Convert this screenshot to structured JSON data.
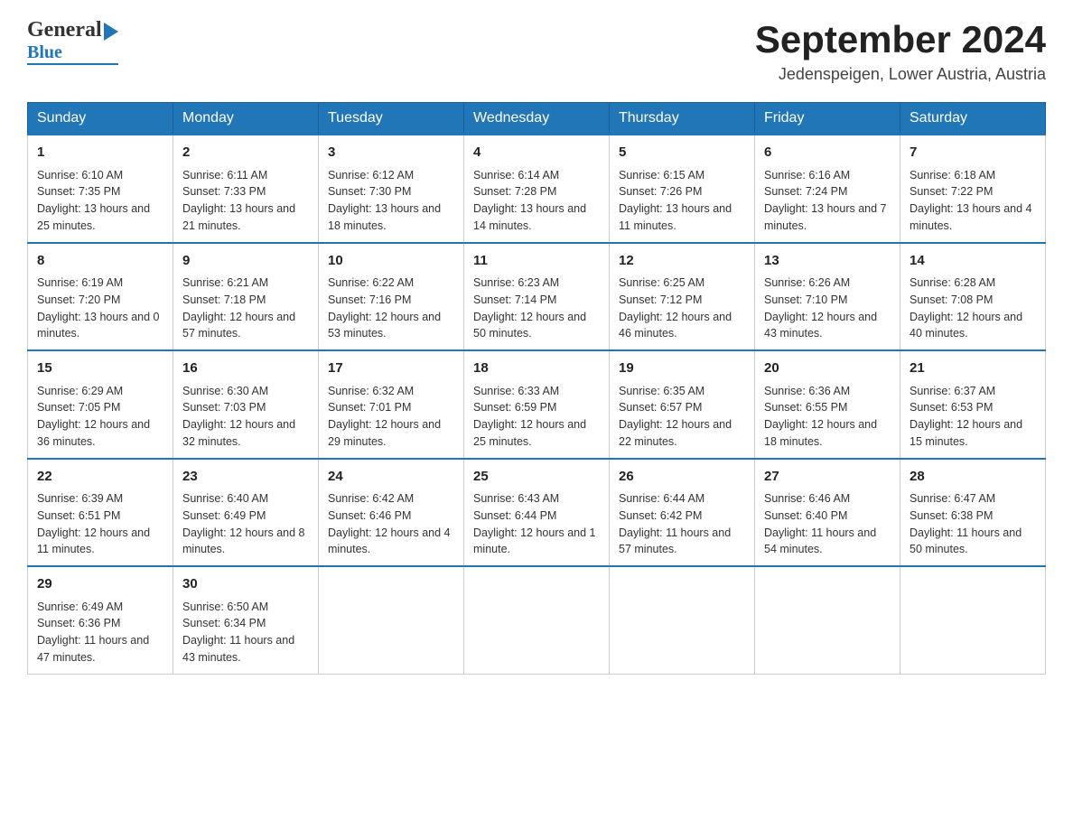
{
  "header": {
    "month_year": "September 2024",
    "location": "Jedenspeigen, Lower Austria, Austria",
    "logo_general": "General",
    "logo_blue": "Blue"
  },
  "weekdays": [
    "Sunday",
    "Monday",
    "Tuesday",
    "Wednesday",
    "Thursday",
    "Friday",
    "Saturday"
  ],
  "weeks": [
    [
      {
        "day": "1",
        "sunrise": "Sunrise: 6:10 AM",
        "sunset": "Sunset: 7:35 PM",
        "daylight": "Daylight: 13 hours and 25 minutes."
      },
      {
        "day": "2",
        "sunrise": "Sunrise: 6:11 AM",
        "sunset": "Sunset: 7:33 PM",
        "daylight": "Daylight: 13 hours and 21 minutes."
      },
      {
        "day": "3",
        "sunrise": "Sunrise: 6:12 AM",
        "sunset": "Sunset: 7:30 PM",
        "daylight": "Daylight: 13 hours and 18 minutes."
      },
      {
        "day": "4",
        "sunrise": "Sunrise: 6:14 AM",
        "sunset": "Sunset: 7:28 PM",
        "daylight": "Daylight: 13 hours and 14 minutes."
      },
      {
        "day": "5",
        "sunrise": "Sunrise: 6:15 AM",
        "sunset": "Sunset: 7:26 PM",
        "daylight": "Daylight: 13 hours and 11 minutes."
      },
      {
        "day": "6",
        "sunrise": "Sunrise: 6:16 AM",
        "sunset": "Sunset: 7:24 PM",
        "daylight": "Daylight: 13 hours and 7 minutes."
      },
      {
        "day": "7",
        "sunrise": "Sunrise: 6:18 AM",
        "sunset": "Sunset: 7:22 PM",
        "daylight": "Daylight: 13 hours and 4 minutes."
      }
    ],
    [
      {
        "day": "8",
        "sunrise": "Sunrise: 6:19 AM",
        "sunset": "Sunset: 7:20 PM",
        "daylight": "Daylight: 13 hours and 0 minutes."
      },
      {
        "day": "9",
        "sunrise": "Sunrise: 6:21 AM",
        "sunset": "Sunset: 7:18 PM",
        "daylight": "Daylight: 12 hours and 57 minutes."
      },
      {
        "day": "10",
        "sunrise": "Sunrise: 6:22 AM",
        "sunset": "Sunset: 7:16 PM",
        "daylight": "Daylight: 12 hours and 53 minutes."
      },
      {
        "day": "11",
        "sunrise": "Sunrise: 6:23 AM",
        "sunset": "Sunset: 7:14 PM",
        "daylight": "Daylight: 12 hours and 50 minutes."
      },
      {
        "day": "12",
        "sunrise": "Sunrise: 6:25 AM",
        "sunset": "Sunset: 7:12 PM",
        "daylight": "Daylight: 12 hours and 46 minutes."
      },
      {
        "day": "13",
        "sunrise": "Sunrise: 6:26 AM",
        "sunset": "Sunset: 7:10 PM",
        "daylight": "Daylight: 12 hours and 43 minutes."
      },
      {
        "day": "14",
        "sunrise": "Sunrise: 6:28 AM",
        "sunset": "Sunset: 7:08 PM",
        "daylight": "Daylight: 12 hours and 40 minutes."
      }
    ],
    [
      {
        "day": "15",
        "sunrise": "Sunrise: 6:29 AM",
        "sunset": "Sunset: 7:05 PM",
        "daylight": "Daylight: 12 hours and 36 minutes."
      },
      {
        "day": "16",
        "sunrise": "Sunrise: 6:30 AM",
        "sunset": "Sunset: 7:03 PM",
        "daylight": "Daylight: 12 hours and 32 minutes."
      },
      {
        "day": "17",
        "sunrise": "Sunrise: 6:32 AM",
        "sunset": "Sunset: 7:01 PM",
        "daylight": "Daylight: 12 hours and 29 minutes."
      },
      {
        "day": "18",
        "sunrise": "Sunrise: 6:33 AM",
        "sunset": "Sunset: 6:59 PM",
        "daylight": "Daylight: 12 hours and 25 minutes."
      },
      {
        "day": "19",
        "sunrise": "Sunrise: 6:35 AM",
        "sunset": "Sunset: 6:57 PM",
        "daylight": "Daylight: 12 hours and 22 minutes."
      },
      {
        "day": "20",
        "sunrise": "Sunrise: 6:36 AM",
        "sunset": "Sunset: 6:55 PM",
        "daylight": "Daylight: 12 hours and 18 minutes."
      },
      {
        "day": "21",
        "sunrise": "Sunrise: 6:37 AM",
        "sunset": "Sunset: 6:53 PM",
        "daylight": "Daylight: 12 hours and 15 minutes."
      }
    ],
    [
      {
        "day": "22",
        "sunrise": "Sunrise: 6:39 AM",
        "sunset": "Sunset: 6:51 PM",
        "daylight": "Daylight: 12 hours and 11 minutes."
      },
      {
        "day": "23",
        "sunrise": "Sunrise: 6:40 AM",
        "sunset": "Sunset: 6:49 PM",
        "daylight": "Daylight: 12 hours and 8 minutes."
      },
      {
        "day": "24",
        "sunrise": "Sunrise: 6:42 AM",
        "sunset": "Sunset: 6:46 PM",
        "daylight": "Daylight: 12 hours and 4 minutes."
      },
      {
        "day": "25",
        "sunrise": "Sunrise: 6:43 AM",
        "sunset": "Sunset: 6:44 PM",
        "daylight": "Daylight: 12 hours and 1 minute."
      },
      {
        "day": "26",
        "sunrise": "Sunrise: 6:44 AM",
        "sunset": "Sunset: 6:42 PM",
        "daylight": "Daylight: 11 hours and 57 minutes."
      },
      {
        "day": "27",
        "sunrise": "Sunrise: 6:46 AM",
        "sunset": "Sunset: 6:40 PM",
        "daylight": "Daylight: 11 hours and 54 minutes."
      },
      {
        "day": "28",
        "sunrise": "Sunrise: 6:47 AM",
        "sunset": "Sunset: 6:38 PM",
        "daylight": "Daylight: 11 hours and 50 minutes."
      }
    ],
    [
      {
        "day": "29",
        "sunrise": "Sunrise: 6:49 AM",
        "sunset": "Sunset: 6:36 PM",
        "daylight": "Daylight: 11 hours and 47 minutes."
      },
      {
        "day": "30",
        "sunrise": "Sunrise: 6:50 AM",
        "sunset": "Sunset: 6:34 PM",
        "daylight": "Daylight: 11 hours and 43 minutes."
      },
      null,
      null,
      null,
      null,
      null
    ]
  ]
}
